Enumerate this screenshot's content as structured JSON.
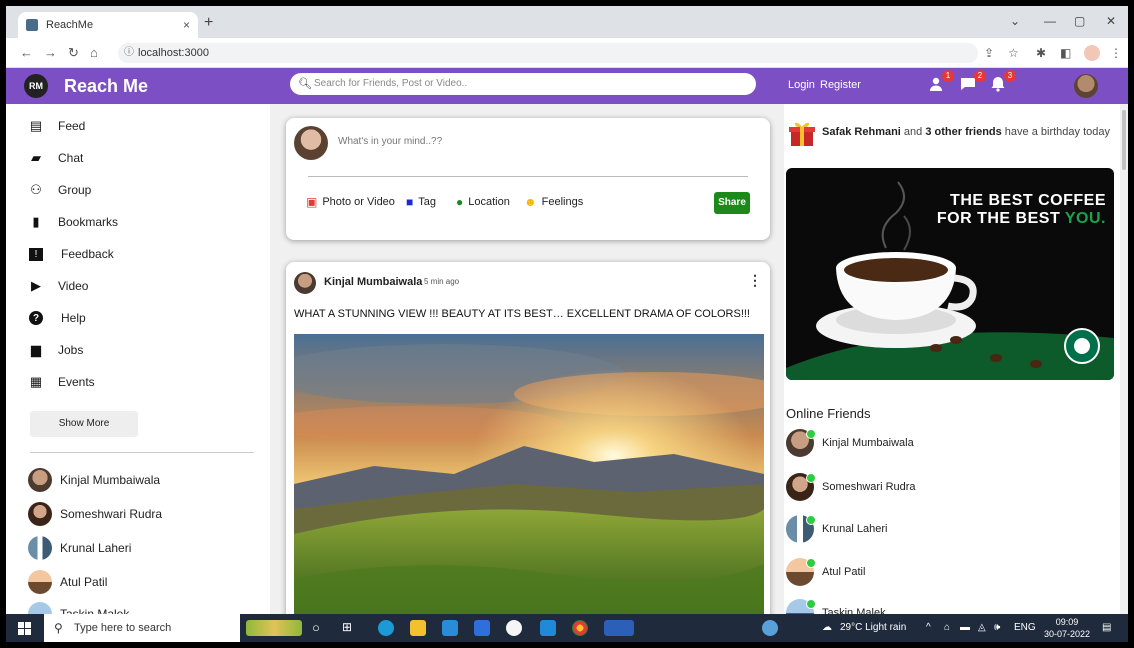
{
  "browser": {
    "tab_title": "ReachMe",
    "tab_close": "×",
    "new_tab": "+",
    "url": "localhost:3000"
  },
  "header": {
    "logo_text": "RM",
    "brand": "Reach Me",
    "search_placeholder": "Search for Friends, Post or Video..",
    "login": "Login",
    "register": "Register",
    "badges": {
      "friends": "1",
      "messages": "2",
      "notifications": "3"
    }
  },
  "sidebar": {
    "items": [
      {
        "label": "Feed",
        "icon": "feed-icon",
        "glyph": "▤"
      },
      {
        "label": "Chat",
        "icon": "chat-icon",
        "glyph": "▰"
      },
      {
        "label": "Group",
        "icon": "group-icon",
        "glyph": "👥"
      },
      {
        "label": "Bookmarks",
        "icon": "bookmark-icon",
        "glyph": "▮"
      },
      {
        "label": "Feedback",
        "icon": "feedback-icon",
        "glyph": "!"
      },
      {
        "label": "Video",
        "icon": "video-icon",
        "glyph": "▶"
      },
      {
        "label": "Help",
        "icon": "help-icon",
        "glyph": "?"
      },
      {
        "label": "Jobs",
        "icon": "jobs-icon",
        "glyph": "💼"
      },
      {
        "label": "Events",
        "icon": "events-icon",
        "glyph": "▦"
      }
    ],
    "show_more": "Show More",
    "friends": [
      "Kinjal Mumbaiwala",
      "Someshwari Rudra",
      "Krunal Laheri",
      "Atul Patil",
      "Taskin Malek"
    ]
  },
  "share": {
    "placeholder": "What's in your mind..??",
    "options": [
      "Photo or Video",
      "Tag",
      "Location",
      "Feelings"
    ],
    "share_button": "Share"
  },
  "post": {
    "author": "Kinjal Mumbaiwala",
    "time": "5 min ago",
    "text": "WHAT A STUNNING VIEW !!! BEAUTY AT ITS BEST… EXCELLENT DRAMA OF COLORS!!!"
  },
  "right": {
    "birthday_name": "Safak Rehmani",
    "birthday_mid": " and ",
    "birthday_count": "3 other friends",
    "birthday_tail": " have a birthday today",
    "ad_line1": "THE BEST COFFEE",
    "ad_line2_a": "FOR THE BEST ",
    "ad_line2_b": "YOU.",
    "online_title": "Online Friends",
    "online_friends": [
      "Kinjal Mumbaiwala",
      "Someshwari Rudra",
      "Krunal Laheri",
      "Atul Patil",
      "Taskin Malek"
    ]
  },
  "taskbar": {
    "search": "Type here to search",
    "weather": "29°C  Light rain",
    "lang": "ENG",
    "time": "09:09",
    "date": "30-07-2022"
  },
  "colors": {
    "accent": "#7c4fc4",
    "share": "#1b8a1b",
    "online": "#2ecc40"
  }
}
